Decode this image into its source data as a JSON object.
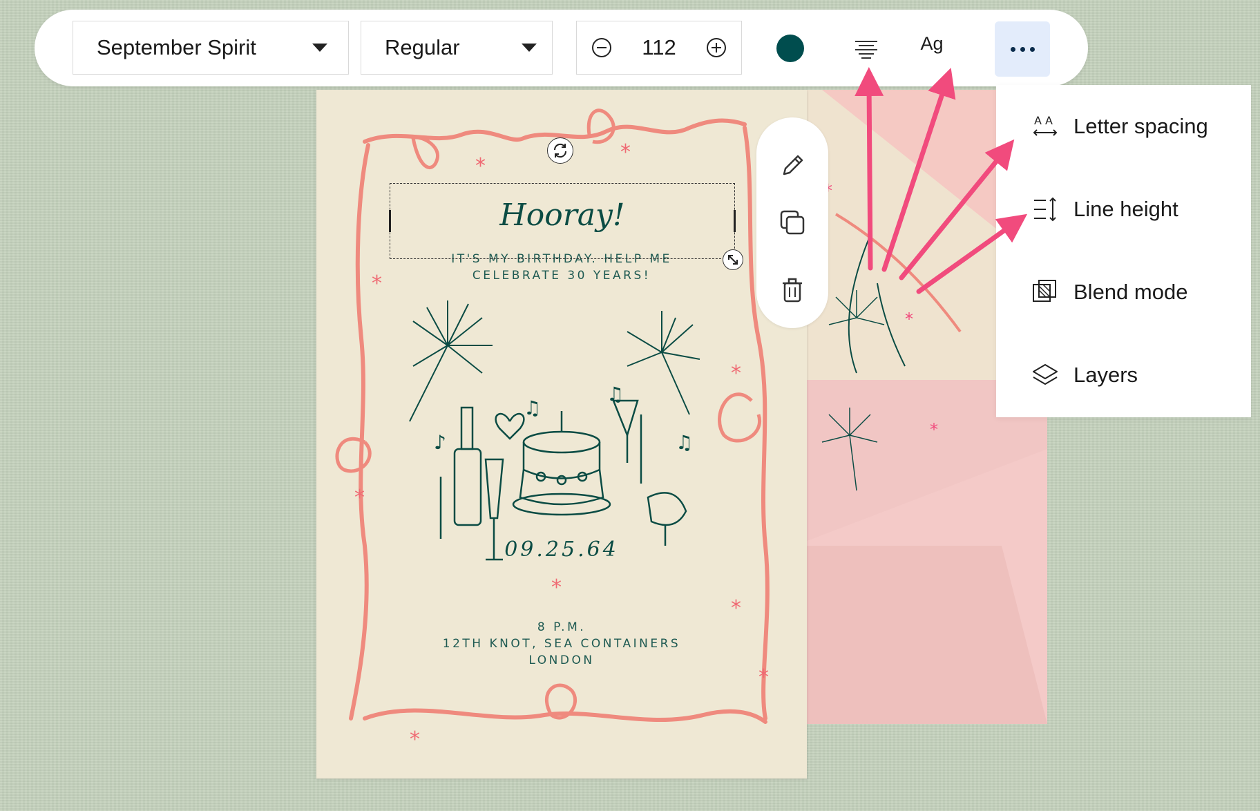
{
  "toolbar": {
    "font_family": "September Spirit",
    "font_weight": "Regular",
    "font_size": "112",
    "text_color": "#004d4e",
    "typography_label": "Ag",
    "icons": {
      "font_dropdown": "chevron-down-icon",
      "weight_dropdown": "chevron-down-icon",
      "decrease": "minus-circle-icon",
      "increase": "plus-circle-icon",
      "align": "align-center-icon",
      "more": "more-horizontal-icon"
    }
  },
  "menu": {
    "items": [
      {
        "label": "Letter spacing",
        "icon": "letter-spacing-icon"
      },
      {
        "label": "Line height",
        "icon": "line-height-icon"
      },
      {
        "label": "Blend mode",
        "icon": "blend-mode-icon"
      },
      {
        "label": "Layers",
        "icon": "layers-icon"
      }
    ]
  },
  "side_tools": {
    "items": [
      {
        "name": "edit",
        "icon": "pencil-icon"
      },
      {
        "name": "duplicate",
        "icon": "duplicate-icon"
      },
      {
        "name": "delete",
        "icon": "trash-icon"
      }
    ]
  },
  "card": {
    "title": "Hooray!",
    "subtitle_line1": "IT'S MY BIRTHDAY. HELP ME",
    "subtitle_line2": "CELEBRATE 30 YEARS!",
    "date": "09.25.64",
    "time": "8 P.M.",
    "venue": "12TH KNOT, SEA CONTAINERS",
    "city": "LONDON"
  },
  "colors": {
    "accent_pink": "#f14b7d",
    "ink_green": "#0b4c44",
    "ribbon": "#ef8a7e",
    "card_bg": "#efe8d4",
    "envelope": "#efc3c2",
    "more_button_bg": "#e3ecfb"
  }
}
